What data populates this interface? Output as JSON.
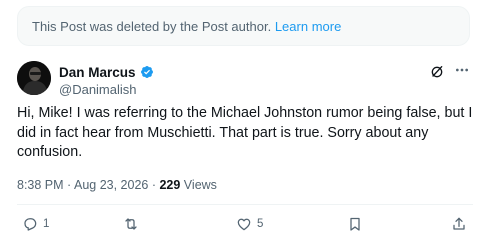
{
  "deleted_notice": {
    "text": "This Post was deleted by the Post author.",
    "link": "Learn more"
  },
  "author": {
    "display_name": "Dan Marcus",
    "handle": "@Danimalish",
    "verified": true
  },
  "post": {
    "text": "Hi, Mike! I was referring to the Michael Johnston rumor being false, but I did in fact hear from Muschietti. That part is true. Sorry about any confusion."
  },
  "meta": {
    "time": "8:38 PM",
    "separator1": " · ",
    "date": "Aug 23, 2026",
    "separator2": " · ",
    "views_count": "229",
    "views_label": " Views"
  },
  "actions": {
    "reply_count": "1",
    "retweet_count": "",
    "like_count": "5"
  },
  "colors": {
    "accent": "#1d9bf0",
    "muted": "#536471",
    "text": "#0f1419",
    "verified": "#1d9bf0"
  },
  "icons": [
    "grok-icon",
    "more-icon",
    "verified-badge-icon",
    "reply-icon",
    "retweet-icon",
    "like-icon",
    "bookmark-icon",
    "share-icon"
  ]
}
